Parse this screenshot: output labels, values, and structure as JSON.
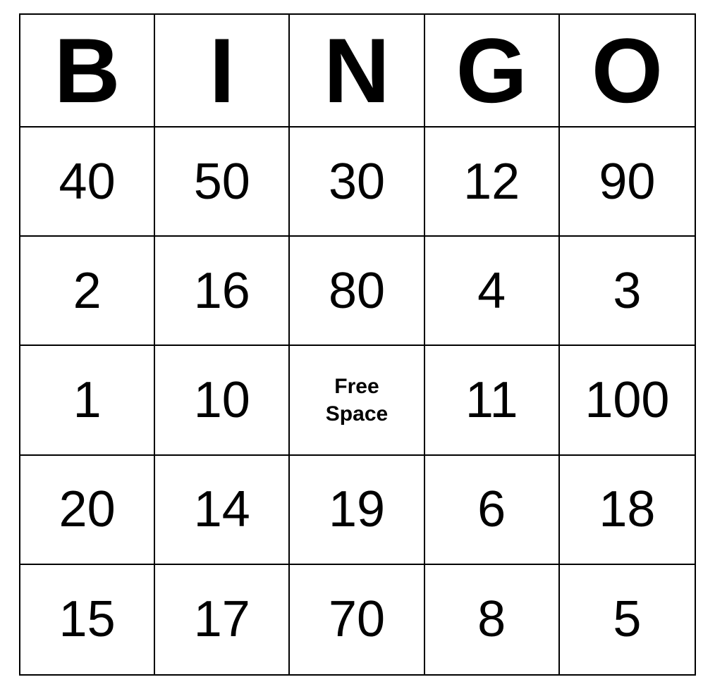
{
  "header": {
    "letters": [
      "B",
      "I",
      "N",
      "G",
      "O"
    ]
  },
  "grid": {
    "rows": [
      [
        {
          "value": "40",
          "isFreeSpace": false
        },
        {
          "value": "50",
          "isFreeSpace": false
        },
        {
          "value": "30",
          "isFreeSpace": false
        },
        {
          "value": "12",
          "isFreeSpace": false
        },
        {
          "value": "90",
          "isFreeSpace": false
        }
      ],
      [
        {
          "value": "2",
          "isFreeSpace": false
        },
        {
          "value": "16",
          "isFreeSpace": false
        },
        {
          "value": "80",
          "isFreeSpace": false
        },
        {
          "value": "4",
          "isFreeSpace": false
        },
        {
          "value": "3",
          "isFreeSpace": false
        }
      ],
      [
        {
          "value": "1",
          "isFreeSpace": false
        },
        {
          "value": "10",
          "isFreeSpace": false
        },
        {
          "value": "Free Space",
          "isFreeSpace": true
        },
        {
          "value": "11",
          "isFreeSpace": false
        },
        {
          "value": "100",
          "isFreeSpace": false
        }
      ],
      [
        {
          "value": "20",
          "isFreeSpace": false
        },
        {
          "value": "14",
          "isFreeSpace": false
        },
        {
          "value": "19",
          "isFreeSpace": false
        },
        {
          "value": "6",
          "isFreeSpace": false
        },
        {
          "value": "18",
          "isFreeSpace": false
        }
      ],
      [
        {
          "value": "15",
          "isFreeSpace": false
        },
        {
          "value": "17",
          "isFreeSpace": false
        },
        {
          "value": "70",
          "isFreeSpace": false
        },
        {
          "value": "8",
          "isFreeSpace": false
        },
        {
          "value": "5",
          "isFreeSpace": false
        }
      ]
    ]
  }
}
